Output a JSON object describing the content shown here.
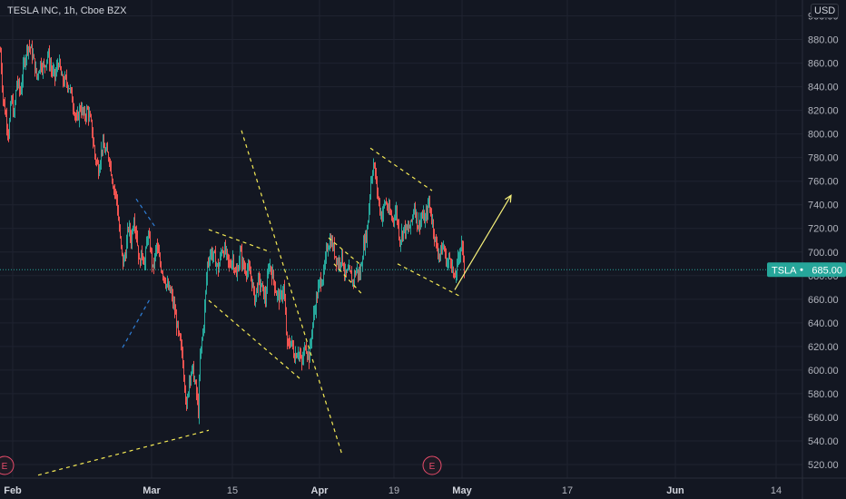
{
  "chart_data": {
    "type": "candlestick",
    "title": "TESLA INC, 1h, Cboe BZX",
    "currency": "USD",
    "symbol": "TSLA",
    "last_price": 685.0,
    "last_price_text": "685.00",
    "price_label": "TSLA",
    "ylim": [
      510,
      925
    ],
    "y_ticks": [
      520,
      540,
      560,
      580,
      600,
      620,
      640,
      660,
      680,
      700,
      720,
      740,
      760,
      780,
      800,
      820,
      840,
      860,
      880,
      900
    ],
    "y_tick_labels": [
      "520.00",
      "540.00",
      "560.00",
      "580.00",
      "600.00",
      "620.00",
      "640.00",
      "660.00",
      "680.00",
      "700.00",
      "720.00",
      "740.00",
      "760.00",
      "780.00",
      "800.00",
      "820.00",
      "840.00",
      "860.00",
      "880.00",
      "900.00"
    ],
    "x_ticks": [
      {
        "label": "Feb",
        "bold": true
      },
      {
        "label": "Mar",
        "bold": true
      },
      {
        "label": "15",
        "bold": false
      },
      {
        "label": "Apr",
        "bold": true
      },
      {
        "label": "19",
        "bold": false
      },
      {
        "label": "May",
        "bold": true
      },
      {
        "label": "17",
        "bold": false
      },
      {
        "label": "Jun",
        "bold": true
      },
      {
        "label": "14",
        "bold": false
      }
    ],
    "grid": true,
    "colors": {
      "up": "#26a69a",
      "down": "#ef5350",
      "trend": "#f5ea55",
      "blue_trend": "#2f7fd8",
      "arrow": "#f6f07a",
      "earnings": "#e84c6b",
      "price_line": "#26a69a",
      "background": "#131722",
      "grid": "#1f2330",
      "text": "#b2b5be"
    },
    "price_path": [
      [
        0,
        870
      ],
      [
        3,
        830
      ],
      [
        6,
        815
      ],
      [
        9,
        800
      ],
      [
        12,
        830
      ],
      [
        15,
        815
      ],
      [
        18,
        845
      ],
      [
        22,
        835
      ],
      [
        26,
        860
      ],
      [
        30,
        875
      ],
      [
        33,
        873
      ],
      [
        36,
        865
      ],
      [
        40,
        848
      ],
      [
        44,
        860
      ],
      [
        48,
        856
      ],
      [
        52,
        868
      ],
      [
        56,
        855
      ],
      [
        60,
        848
      ],
      [
        64,
        862
      ],
      [
        68,
        845
      ],
      [
        72,
        845
      ],
      [
        76,
        840
      ],
      [
        80,
        826
      ],
      [
        84,
        810
      ],
      [
        88,
        823
      ],
      [
        92,
        815
      ],
      [
        96,
        820
      ],
      [
        100,
        808
      ],
      [
        104,
        782
      ],
      [
        108,
        770
      ],
      [
        112,
        790
      ],
      [
        116,
        785
      ],
      [
        120,
        780
      ],
      [
        124,
        758
      ],
      [
        128,
        745
      ],
      [
        132,
        710
      ],
      [
        135,
        690
      ],
      [
        138,
        700
      ],
      [
        141,
        722
      ],
      [
        144,
        710
      ],
      [
        147,
        730
      ],
      [
        150,
        715
      ],
      [
        153,
        690
      ],
      [
        156,
        700
      ],
      [
        159,
        690
      ],
      [
        162,
        715
      ],
      [
        165,
        705
      ],
      [
        168,
        685
      ],
      [
        172,
        705
      ],
      [
        176,
        690
      ],
      [
        180,
        680
      ],
      [
        184,
        670
      ],
      [
        188,
        665
      ],
      [
        192,
        650
      ],
      [
        196,
        630
      ],
      [
        200,
        615
      ],
      [
        203,
        590
      ],
      [
        205,
        565
      ],
      [
        208,
        595
      ],
      [
        212,
        600
      ],
      [
        216,
        580
      ],
      [
        218,
        565
      ],
      [
        220,
        610
      ],
      [
        224,
        640
      ],
      [
        228,
        690
      ],
      [
        232,
        700
      ],
      [
        236,
        695
      ],
      [
        240,
        685
      ],
      [
        244,
        703
      ],
      [
        248,
        700
      ],
      [
        252,
        688
      ],
      [
        256,
        695
      ],
      [
        260,
        678
      ],
      [
        264,
        700
      ],
      [
        268,
        687
      ],
      [
        272,
        685
      ],
      [
        276,
        680
      ],
      [
        280,
        660
      ],
      [
        284,
        675
      ],
      [
        288,
        670
      ],
      [
        292,
        660
      ],
      [
        296,
        690
      ],
      [
        300,
        680
      ],
      [
        304,
        665
      ],
      [
        308,
        660
      ],
      [
        312,
        670
      ],
      [
        316,
        620
      ],
      [
        320,
        625
      ],
      [
        324,
        612
      ],
      [
        328,
        617
      ],
      [
        332,
        605
      ],
      [
        336,
        622
      ],
      [
        340,
        610
      ],
      [
        344,
        640
      ],
      [
        348,
        660
      ],
      [
        352,
        675
      ],
      [
        356,
        680
      ],
      [
        360,
        705
      ],
      [
        364,
        710
      ],
      [
        368,
        700
      ],
      [
        372,
        690
      ],
      [
        376,
        697
      ],
      [
        380,
        680
      ],
      [
        384,
        683
      ],
      [
        388,
        675
      ],
      [
        392,
        685
      ],
      [
        396,
        680
      ],
      [
        400,
        705
      ],
      [
        404,
        718
      ],
      [
        408,
        760
      ],
      [
        411,
        775
      ],
      [
        414,
        760
      ],
      [
        417,
        740
      ],
      [
        420,
        730
      ],
      [
        424,
        743
      ],
      [
        428,
        734
      ],
      [
        432,
        728
      ],
      [
        436,
        735
      ],
      [
        440,
        710
      ],
      [
        444,
        720
      ],
      [
        448,
        718
      ],
      [
        452,
        722
      ],
      [
        456,
        740
      ],
      [
        460,
        722
      ],
      [
        464,
        730
      ],
      [
        468,
        727
      ],
      [
        472,
        742
      ],
      [
        476,
        725
      ],
      [
        480,
        705
      ],
      [
        484,
        698
      ],
      [
        488,
        705
      ],
      [
        492,
        690
      ],
      [
        496,
        696
      ],
      [
        500,
        675
      ],
      [
        504,
        692
      ],
      [
        508,
        710
      ],
      [
        511,
        683
      ]
    ],
    "trend_lines": [
      {
        "name": "support-line",
        "color": "#f5ea55",
        "dashed": true,
        "points": [
          [
            42,
            511
          ],
          [
            230,
            549
          ]
        ]
      },
      {
        "name": "wedge-upper",
        "color": "#f5ea55",
        "dashed": true,
        "points": [
          [
            230,
            719
          ],
          [
            298,
            700
          ]
        ]
      },
      {
        "name": "wedge-lower",
        "color": "#f5ea55",
        "dashed": true,
        "points": [
          [
            230,
            659
          ],
          [
            330,
            593
          ]
        ]
      },
      {
        "name": "breakout-line",
        "color": "#f5ea55",
        "dashed": true,
        "points": [
          [
            266,
            803
          ],
          [
            377,
            528
          ]
        ]
      },
      {
        "name": "apr-up",
        "color": "#f5ea55",
        "dashed": true,
        "points": [
          [
            362,
            712
          ],
          [
            396,
            690
          ]
        ]
      },
      {
        "name": "apr-low",
        "color": "#f5ea55",
        "dashed": true,
        "points": [
          [
            368,
            690
          ],
          [
            398,
            665
          ]
        ]
      },
      {
        "name": "channel-upper",
        "color": "#f5ea55",
        "dashed": true,
        "points": [
          [
            408,
            788
          ],
          [
            476,
            752
          ]
        ]
      },
      {
        "name": "channel-lower",
        "color": "#f5ea55",
        "dashed": true,
        "points": [
          [
            438,
            690
          ],
          [
            508,
            662
          ]
        ]
      },
      {
        "name": "blue-upper",
        "color": "#2f7fd8",
        "dashed": true,
        "points": [
          [
            150,
            745
          ],
          [
            172,
            720
          ]
        ]
      },
      {
        "name": "blue-lower",
        "color": "#2f7fd8",
        "dashed": true,
        "points": [
          [
            135,
            619
          ],
          [
            165,
            660
          ]
        ]
      }
    ],
    "forecast_arrow": {
      "from": [
        501,
        668
      ],
      "to": [
        563,
        748
      ]
    },
    "earnings_markers": [
      {
        "label": "E",
        "x": 5
      },
      {
        "label": "E",
        "x": 476
      }
    ]
  }
}
